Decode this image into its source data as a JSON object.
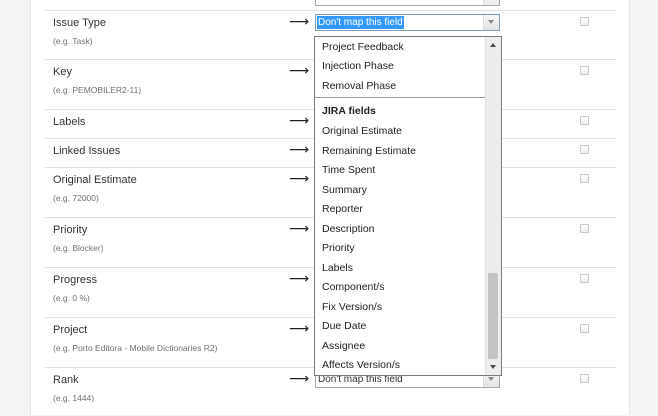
{
  "arrow_glyph": "⟶",
  "rows": [
    {
      "name": "Issue Type",
      "example": "(e.g. Task)"
    },
    {
      "name": "Key",
      "example": "(e.g. PEMOBILER2-11)"
    },
    {
      "name": "Labels",
      "example": ""
    },
    {
      "name": "Linked Issues",
      "example": ""
    },
    {
      "name": "Original Estimate",
      "example": "(e.g. 72000)"
    },
    {
      "name": "Priority",
      "example": "(e.g. Blocker)"
    },
    {
      "name": "Progress",
      "example": "(e.g. 0 %)"
    },
    {
      "name": "Project",
      "example": "(e.g. Porto Editora - Mobile Dictionaries R2)"
    },
    {
      "name": "Rank",
      "example": "(e.g. 1444)"
    }
  ],
  "select_value": "Don't map this field",
  "dropdown": {
    "items_top": [
      "Project Feedback",
      "Injection Phase",
      "Removal Phase"
    ],
    "group_label": "JIRA fields",
    "items_jira": [
      "Original Estimate",
      "Remaining Estimate",
      "Time Spent",
      "Summary",
      "Reporter",
      "Description",
      "Priority",
      "Labels",
      "Component/s",
      "Fix Version/s",
      "Due Date",
      "Assignee",
      "Affects Version/s"
    ]
  },
  "colors": {
    "selection_highlight": "#3399ff",
    "divider": "#e2e2e2"
  }
}
